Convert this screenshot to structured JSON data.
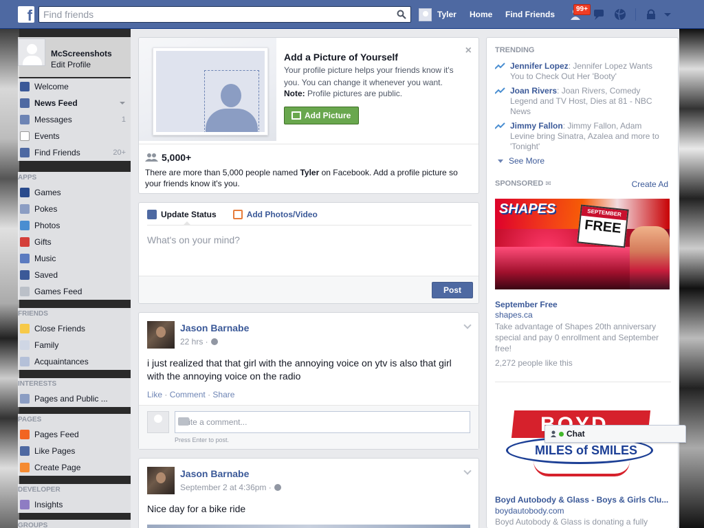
{
  "topbar": {
    "logo": "f",
    "search_placeholder": "Find friends",
    "user_name": "Tyler",
    "home": "Home",
    "find_friends": "Find Friends",
    "notif_badge": "99+"
  },
  "sidebar": {
    "profile_name": "McScreenshots",
    "edit_profile": "Edit Profile",
    "favorites": [
      {
        "label": "Welcome",
        "icon": "facebook-icon",
        "count": ""
      },
      {
        "label": "News Feed",
        "icon": "news-feed-icon",
        "count": ""
      },
      {
        "label": "Messages",
        "icon": "messages-icon",
        "count": "1"
      },
      {
        "label": "Events",
        "icon": "calendar-icon",
        "count": ""
      },
      {
        "label": "Find Friends",
        "icon": "find-friends-icon",
        "count": "20+"
      }
    ],
    "apps_header": "APPS",
    "apps": [
      {
        "label": "Games",
        "icon": "games-icon"
      },
      {
        "label": "Pokes",
        "icon": "pokes-icon"
      },
      {
        "label": "Photos",
        "icon": "photos-icon"
      },
      {
        "label": "Gifts",
        "icon": "gifts-icon"
      },
      {
        "label": "Music",
        "icon": "music-icon"
      },
      {
        "label": "Saved",
        "icon": "saved-icon"
      },
      {
        "label": "Games Feed",
        "icon": "games-feed-icon"
      }
    ],
    "friends_header": "FRIENDS",
    "friends": [
      {
        "label": "Close Friends",
        "icon": "star-icon"
      },
      {
        "label": "Family",
        "icon": "family-icon"
      },
      {
        "label": "Acquaintances",
        "icon": "acquaintances-icon"
      }
    ],
    "interests_header": "INTERESTS",
    "interests": [
      {
        "label": "Pages and Public ...",
        "icon": "pages-public-icon"
      }
    ],
    "pages_header": "PAGES",
    "pages": [
      {
        "label": "Pages Feed",
        "icon": "pages-feed-icon"
      },
      {
        "label": "Like Pages",
        "icon": "like-icon"
      },
      {
        "label": "Create Page",
        "icon": "create-page-icon"
      }
    ],
    "developer_header": "DEVELOPER",
    "developer": [
      {
        "label": "Insights",
        "icon": "insights-icon"
      }
    ],
    "groups_header": "GROUPS"
  },
  "addpic": {
    "title": "Add a Picture of Yourself",
    "text": "Your profile picture helps your friends know it's you. You can change it whenever you want.",
    "note_bold": "Note:",
    "note_text": " Profile pictures are public.",
    "button": "Add Picture",
    "close": "×",
    "people_count": "5,000+",
    "people_text_1": "There are more than 5,000 people named ",
    "people_name": "Tyler",
    "people_text_2": " on Facebook. Add a profile picture so your friends know it's you."
  },
  "composer": {
    "tab_status": "Update Status",
    "tab_photos": "Add Photos/Video",
    "placeholder": "What's on your mind?",
    "post_button": "Post"
  },
  "posts": [
    {
      "author": "Jason Barnabe",
      "time": "22 hrs ·",
      "body": "i just realized that that girl with the annoying voice on ytv is also that girl with the annoying voice on the radio",
      "like": "Like",
      "comment": "Comment",
      "share": "Share",
      "comment_placeholder": "Write a comment...",
      "comment_hint": "Press Enter to post."
    },
    {
      "author": "Jason Barnabe",
      "time": "September 2 at 4:36pm ·",
      "body": "Nice day for a bike ride"
    }
  ],
  "right": {
    "trending_header": "TRENDING",
    "trending": [
      {
        "name": "Jennifer Lopez",
        "text": ": Jennifer Lopez Wants You to Check Out Her 'Booty'"
      },
      {
        "name": "Joan Rivers",
        "text": ": Joan Rivers, Comedy Legend and TV Host, Dies at 81 - NBC News"
      },
      {
        "name": "Jimmy Fallon",
        "text": ": Jimmy Fallon, Adam Levine bring Sinatra, Azalea and more to 'Tonight'"
      }
    ],
    "see_more": "See More",
    "sponsored_header": "SPONSORED",
    "create_ad": "Create Ad",
    "ad1": {
      "logo": "SHAPES",
      "cal_month": "SEPTEMBER",
      "cal_free": "FREE",
      "title": "September Free",
      "url": "shapes.ca",
      "desc": "Take advantage of Shapes 20th anniversary special and pay 0 enrollment and September free!",
      "likes": "2,272 people like this"
    },
    "ad2": {
      "logo": "BOYD",
      "tagline": "MILES of SMILES",
      "title": "Boyd Autobody & Glass - Boys & Girls Clu...",
      "url": "boydautobody.com",
      "desc": "Boyd Autobody & Glass is donating a fully"
    }
  },
  "chat": {
    "label": "Chat"
  }
}
